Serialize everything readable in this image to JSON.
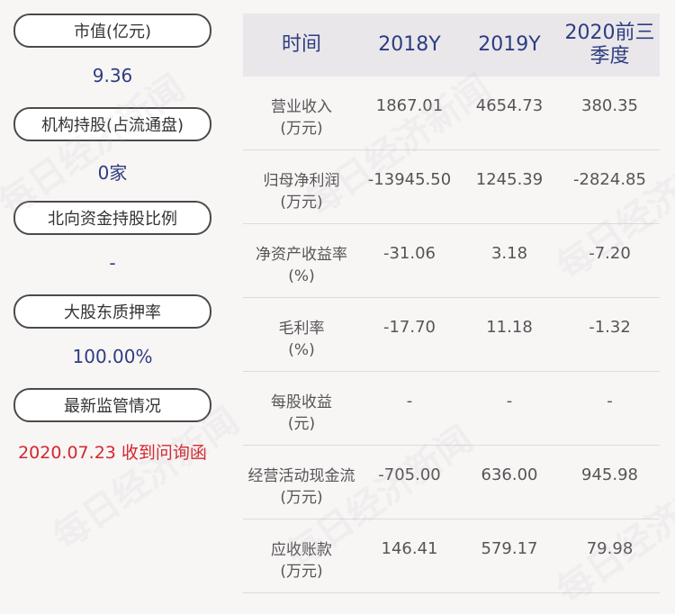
{
  "left_panel": {
    "items": [
      {
        "label": "市值(亿元)",
        "value": "9.36"
      },
      {
        "label": "机构持股(占流通盘)",
        "value": "0家"
      },
      {
        "label": "北向资金持股比例",
        "value": "-"
      },
      {
        "label": "大股东质押率",
        "value": "100.00%"
      },
      {
        "label": "最新监管情况",
        "value": "2020.07.23 收到问询函"
      }
    ]
  },
  "table": {
    "headers": [
      "时间",
      "2018Y",
      "2019Y",
      "2020前三季度"
    ],
    "rows": [
      {
        "label_line1": "营业收入",
        "label_line2": "(万元)",
        "values": [
          "1867.01",
          "4654.73",
          "380.35"
        ]
      },
      {
        "label_line1": "归母净利润",
        "label_line2": "(万元)",
        "values": [
          "-13945.50",
          "1245.39",
          "-2824.85"
        ]
      },
      {
        "label_line1": "净资产收益率",
        "label_line2": "(%)",
        "values": [
          "-31.06",
          "3.18",
          "-7.20"
        ]
      },
      {
        "label_line1": "毛利率",
        "label_line2": "(%)",
        "values": [
          "-17.70",
          "11.18",
          "-1.32"
        ]
      },
      {
        "label_line1": "每股收益",
        "label_line2": "(元)",
        "values": [
          "-",
          "-",
          "-"
        ]
      },
      {
        "label_line1": "经营活动现金流",
        "label_line2": "(万元)",
        "values": [
          "-705.00",
          "636.00",
          "945.98"
        ]
      },
      {
        "label_line1": "应收账款",
        "label_line2": "(万元)",
        "values": [
          "146.41",
          "579.17",
          "79.98"
        ]
      }
    ]
  },
  "watermark_text": "每日经济新闻",
  "colors": {
    "value_blue": "#2e3d82",
    "alert_red": "#d5262e",
    "header_bg": "#e9e7ea"
  }
}
